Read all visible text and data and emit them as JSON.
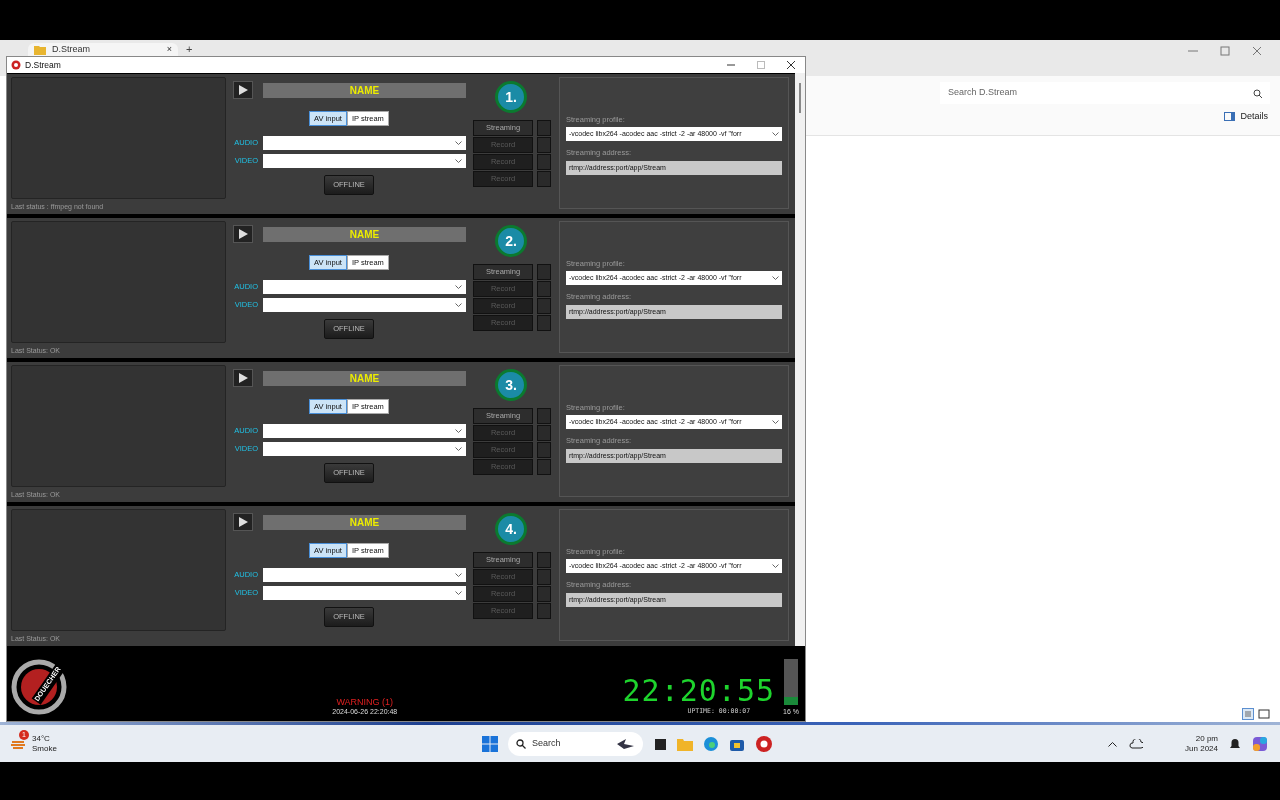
{
  "explorer": {
    "tab_title": "D.Stream",
    "tab_close": "×",
    "new_tab": "+",
    "search_placeholder": "Search D.Stream",
    "details": "Details"
  },
  "app": {
    "title": "D.Stream",
    "channels": [
      {
        "number": "1.",
        "name": "NAME",
        "sources": [
          {
            "label": "AV input",
            "selected": true
          },
          {
            "label": "IP stream",
            "selected": false
          }
        ],
        "audio_label": "AUDIO",
        "video_label": "VIDEO",
        "status_button": "OFFLINE",
        "outputs": [
          {
            "label": "Streaming",
            "disabled": false
          },
          {
            "label": "Record",
            "disabled": true
          },
          {
            "label": "Record",
            "disabled": true
          },
          {
            "label": "Record",
            "disabled": true
          }
        ],
        "profile_label": "Streaming profile:",
        "profile": "-vcodec libx264 -acodec aac -strict -2 -ar 48000 -vf \"forr",
        "address_label": "Streaming address:",
        "address": "rtmp://address:port/app/Stream",
        "last_status": "Last status : ffmpeg not found"
      },
      {
        "number": "2.",
        "name": "NAME",
        "sources": [
          {
            "label": "AV input",
            "selected": true
          },
          {
            "label": "IP stream",
            "selected": false
          }
        ],
        "audio_label": "AUDIO",
        "video_label": "VIDEO",
        "status_button": "OFFLINE",
        "outputs": [
          {
            "label": "Streaming",
            "disabled": false
          },
          {
            "label": "Record",
            "disabled": true
          },
          {
            "label": "Record",
            "disabled": true
          },
          {
            "label": "Record",
            "disabled": true
          }
        ],
        "profile_label": "Streaming profile:",
        "profile": "-vcodec libx264 -acodec aac -strict -2 -ar 48000 -vf \"forr",
        "address_label": "Streaming address:",
        "address": "rtmp://address:port/app/Stream",
        "last_status": "Last Status: OK"
      },
      {
        "number": "3.",
        "name": "NAME",
        "sources": [
          {
            "label": "AV input",
            "selected": true
          },
          {
            "label": "IP stream",
            "selected": false
          }
        ],
        "audio_label": "AUDIO",
        "video_label": "VIDEO",
        "status_button": "OFFLINE",
        "outputs": [
          {
            "label": "Streaming",
            "disabled": false
          },
          {
            "label": "Record",
            "disabled": true
          },
          {
            "label": "Record",
            "disabled": true
          },
          {
            "label": "Record",
            "disabled": true
          }
        ],
        "profile_label": "Streaming profile:",
        "profile": "-vcodec libx264 -acodec aac -strict -2 -ar 48000 -vf \"forr",
        "address_label": "Streaming address:",
        "address": "rtmp://address:port/app/Stream",
        "last_status": "Last Status: OK"
      },
      {
        "number": "4.",
        "name": "NAME",
        "sources": [
          {
            "label": "AV input",
            "selected": true
          },
          {
            "label": "IP stream",
            "selected": false
          }
        ],
        "audio_label": "AUDIO",
        "video_label": "VIDEO",
        "status_button": "OFFLINE",
        "outputs": [
          {
            "label": "Streaming",
            "disabled": false
          },
          {
            "label": "Record",
            "disabled": true
          },
          {
            "label": "Record",
            "disabled": true
          },
          {
            "label": "Record",
            "disabled": true
          }
        ],
        "profile_label": "Streaming profile:",
        "profile": "-vcodec libx264 -acodec aac -strict -2 -ar 48000 -vf \"forr",
        "address_label": "Streaming address:",
        "address": "rtmp://address:port/app/Stream",
        "last_status": "Last Status: OK"
      }
    ],
    "footer": {
      "logo_text": "DOUECHER",
      "warning": "WARNING (1)",
      "warning_time": "2024-06-26 22:20:48",
      "clock": "22:20:55",
      "uptime": "UPTIME: 00:00:07",
      "cpu_meter": {
        "level": 0.16
      },
      "cpu": "16 %"
    }
  },
  "taskbar": {
    "weather_badge": "1",
    "temperature": "34°C",
    "condition": "Smoke",
    "search": "Search",
    "time": "20 pm",
    "date": "Jun 2024"
  }
}
